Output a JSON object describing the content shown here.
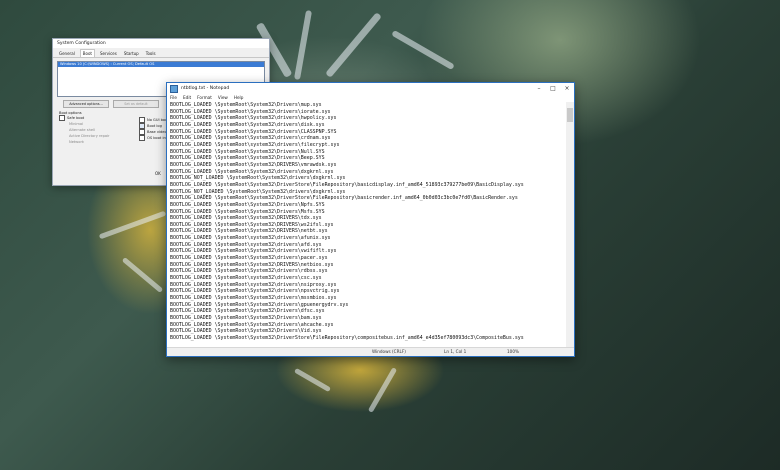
{
  "msconfig": {
    "title": "System Configuration",
    "tabs": [
      "General",
      "Boot",
      "Services",
      "Startup",
      "Tools"
    ],
    "active_tab": "Boot",
    "boot_entry": "Windows 10 (C:\\WINDOWS) : Current OS; Default OS",
    "advanced_button": "Advanced options...",
    "set_default_button": "Set as default",
    "boot_options_label": "Boot options",
    "options_left": [
      "Safe boot",
      "Minimal",
      "Alternate shell",
      "Active Directory repair",
      "Network"
    ],
    "options_right": [
      "No GUI boot",
      "Boot log",
      "Base video",
      "OS boot information"
    ],
    "ok_button": "OK"
  },
  "notepad": {
    "title": "ntbtlog.txt - Notepad",
    "menu": [
      "File",
      "Edit",
      "Format",
      "View",
      "Help"
    ],
    "lines": [
      "BOOTLOG_LOADED \\SystemRoot\\System32\\Drivers\\mup.sys",
      "BOOTLOG_LOADED \\SystemRoot\\System32\\drivers\\iorate.sys",
      "BOOTLOG_LOADED \\SystemRoot\\System32\\drivers\\hwpolicy.sys",
      "BOOTLOG_LOADED \\SystemRoot\\System32\\drivers\\disk.sys",
      "BOOTLOG_LOADED \\SystemRoot\\System32\\drivers\\CLASSPNP.SYS",
      "BOOTLOG_LOADED \\SystemRoot\\System32\\drivers\\crdnam.sys",
      "BOOTLOG_LOADED \\SystemRoot\\system32\\drivers\\filecrypt.sys",
      "BOOTLOG_LOADED \\SystemRoot\\System32\\Drivers\\Null.SYS",
      "BOOTLOG_LOADED \\SystemRoot\\System32\\Drivers\\Beep.SYS",
      "BOOTLOG_LOADED \\SystemRoot\\System32\\DRIVERS\\vmrawdsk.sys",
      "BOOTLOG_LOADED \\SystemRoot\\System32\\drivers\\dxgkrnl.sys",
      "BOOTLOG_NOT_LOADED \\SystemRoot\\System32\\drivers\\dxgkrnl.sys",
      "BOOTLOG_LOADED \\SystemRoot\\System32\\DriverStore\\FileRepository\\basicdisplay.inf_amd64_51893c379277be09\\BasicDisplay.sys",
      "BOOTLOG_NOT_LOADED \\SystemRoot\\System32\\drivers\\dxgkrnl.sys",
      "BOOTLOG_LOADED \\SystemRoot\\System32\\DriverStore\\FileRepository\\basicrender.inf_amd64_0b0d03c3bc0e7fd0\\BasicRender.sys",
      "BOOTLOG_LOADED \\SystemRoot\\System32\\Drivers\\Npfs.SYS",
      "BOOTLOG_LOADED \\SystemRoot\\System32\\Drivers\\Msfs.SYS",
      "BOOTLOG_LOADED \\SystemRoot\\System32\\DRIVERS\\tdx.sys",
      "BOOTLOG_LOADED \\SystemRoot\\System32\\DRIVERS\\ws2ifsl.sys",
      "BOOTLOG_LOADED \\SystemRoot\\System32\\DRIVERS\\netbt.sys",
      "BOOTLOG_LOADED \\SystemRoot\\system32\\drivers\\afunix.sys",
      "BOOTLOG_LOADED \\SystemRoot\\system32\\drivers\\afd.sys",
      "BOOTLOG_LOADED \\SystemRoot\\System32\\drivers\\vwififlt.sys",
      "BOOTLOG_LOADED \\SystemRoot\\System32\\drivers\\pacer.sys",
      "BOOTLOG_LOADED \\SystemRoot\\System32\\DRIVERS\\netbios.sys",
      "BOOTLOG_LOADED \\SystemRoot\\System32\\drivers\\rdbss.sys",
      "BOOTLOG_LOADED \\SystemRoot\\system32\\drivers\\csc.sys",
      "BOOTLOG_LOADED \\SystemRoot\\system32\\drivers\\nsiproxy.sys",
      "BOOTLOG_LOADED \\SystemRoot\\System32\\drivers\\npsvctrig.sys",
      "BOOTLOG_LOADED \\SystemRoot\\System32\\drivers\\mssmbios.sys",
      "BOOTLOG_LOADED \\SystemRoot\\System32\\drivers\\gpuenergydrv.sys",
      "BOOTLOG_LOADED \\SystemRoot\\System32\\Drivers\\dfsc.sys",
      "BOOTLOG_LOADED \\SystemRoot\\System32\\Drivers\\bam.sys",
      "BOOTLOG_LOADED \\SystemRoot\\System32\\drivers\\ahcache.sys",
      "BOOTLOG_LOADED \\SystemRoot\\System32\\Drivers\\Vid.sys",
      "BOOTLOG_LOADED \\SystemRoot\\System32\\DriverStore\\FileRepository\\compositebus.inf_amd64_e4d35ef780093dc3\\CompositeBus.sys"
    ],
    "status": {
      "encoding": "Windows (CRLF)",
      "position": "Ln 1, Col 1",
      "zoom": "100%"
    }
  }
}
